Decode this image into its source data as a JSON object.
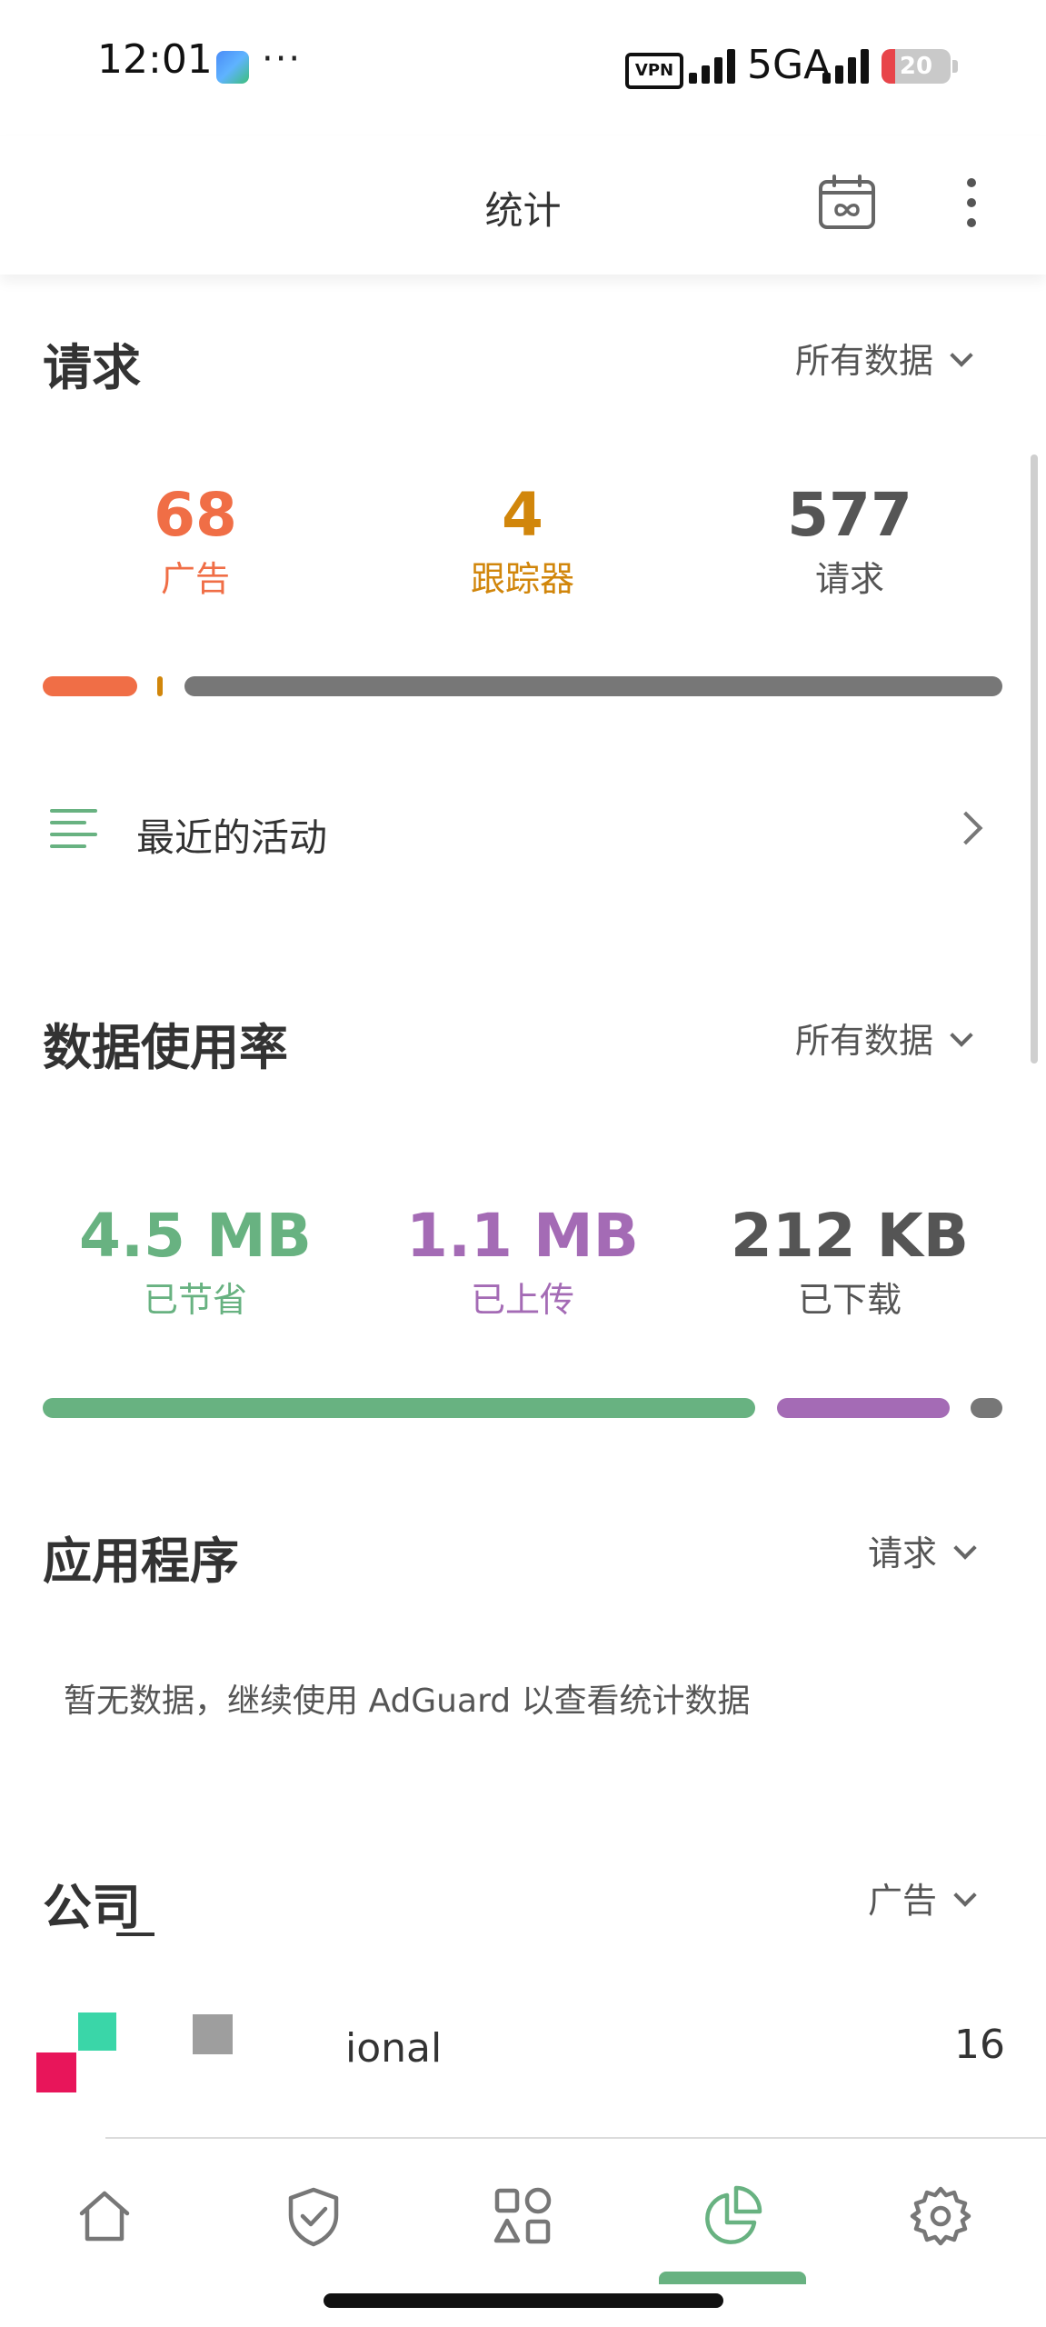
{
  "status_bar": {
    "time": "12:01",
    "dots": "···",
    "vpn": "VPN",
    "network": "5GA",
    "battery": "20",
    "battery_level": 0.2
  },
  "header": {
    "title": "统计"
  },
  "requests": {
    "title": "请求",
    "filter": "所有数据",
    "stats": [
      {
        "value": "68",
        "label": "广告",
        "color": "#f06e46"
      },
      {
        "value": "4",
        "label": "跟踪器",
        "color": "#d1860b"
      },
      {
        "value": "577",
        "label": "请求",
        "color": "#555555"
      }
    ]
  },
  "recent_activity": {
    "label": "最近的活动"
  },
  "data_usage": {
    "title": "数据使用率",
    "filter": "所有数据",
    "stats": [
      {
        "value": "4.5 MB",
        "label": "已节省",
        "color": "#68b281"
      },
      {
        "value": "1.1 MB",
        "label": "已上传",
        "color": "#a46bb5"
      },
      {
        "value": "212 KB",
        "label": "已下载",
        "color": "#555555"
      }
    ]
  },
  "applications": {
    "title": "应用程序",
    "filter": "请求",
    "empty_text": "暂无数据，继续使用 AdGuard 以查看统计数据"
  },
  "companies": {
    "title": "公司",
    "filter": "广告",
    "items": [
      {
        "name": "ional",
        "count": "16"
      }
    ]
  },
  "bottom_nav": {
    "items": [
      "home-icon",
      "shield-icon",
      "apps-icon",
      "statistics-icon",
      "settings-icon"
    ],
    "active": "statistics-icon"
  },
  "colors": {
    "accent": "#68b281",
    "ads": "#f06e46",
    "trackers": "#d1860b",
    "upload": "#a46bb5",
    "neutral": "#777777"
  }
}
